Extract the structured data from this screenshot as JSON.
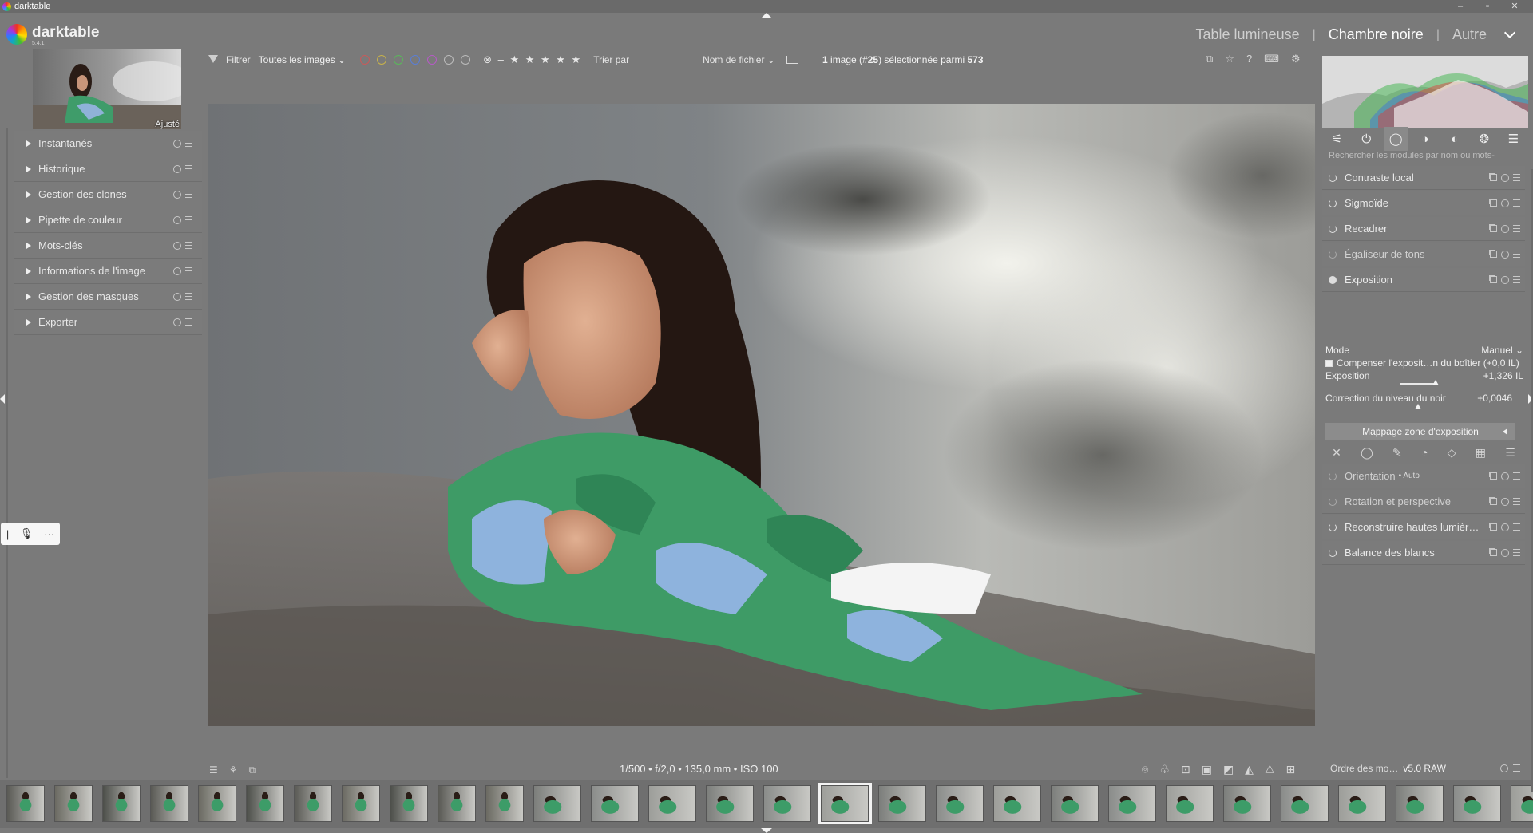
{
  "window": {
    "title": "darktable",
    "controls": [
      "–",
      "▫",
      "✕"
    ]
  },
  "app": {
    "name": "darktable",
    "version": "5.4.1"
  },
  "views": {
    "lighttable": "Table lumineuse",
    "darkroom": "Chambre noire",
    "other": "Autre"
  },
  "filterbar": {
    "filter_label": "Filtrer",
    "filter_value": "Toutes les images",
    "sort_label": "Trier par",
    "sort_value": "Nom de fichier",
    "rating_stars": "⊗ – ★ ★ ★ ★ ★",
    "color_labels": [
      "#c85a5a",
      "#c8b24a",
      "#5ab85a",
      "#5a7ed6",
      "#b65ac6"
    ]
  },
  "selection": {
    "count": "1",
    "text1": " image (#",
    "index": "25",
    "text2": ") sélectionnée parmi ",
    "total": "573"
  },
  "navigation": {
    "label": "Ajusté"
  },
  "left_modules": [
    {
      "label": "Instantanés"
    },
    {
      "label": "Historique"
    },
    {
      "label": "Gestion des clones"
    },
    {
      "label": "Pipette de couleur"
    },
    {
      "label": "Mots-clés"
    },
    {
      "label": "Informations de l'image"
    },
    {
      "label": "Gestion des masques"
    },
    {
      "label": "Exporter"
    }
  ],
  "search": {
    "placeholder": "Rechercher les modules par nom ou mots-"
  },
  "right_modules_top": [
    {
      "label": "Contraste local"
    },
    {
      "label": "Sigmoïde"
    },
    {
      "label": "Recadrer"
    },
    {
      "label": "Égaliseur de tons"
    },
    {
      "label": "Exposition"
    }
  ],
  "exposure": {
    "mode_label": "Mode",
    "mode_value": "Manuel ⌄",
    "compensate_label": "Compenser l'exposit…n du boîtier (+0,0 IL)",
    "exposure_label": "Exposition",
    "exposure_value": "+1,326 IL",
    "black_label": "Correction du niveau du noir",
    "black_value": "+0,0046",
    "zone_button": "Mappage zone d'exposition"
  },
  "right_modules_bottom": [
    {
      "label": "Orientation",
      "tag": "• Auto"
    },
    {
      "label": "Rotation et perspective",
      "tag": ""
    },
    {
      "label": "Reconstruire hautes lumièr…",
      "tag": ""
    },
    {
      "label": "Balance des blancs",
      "tag": ""
    }
  ],
  "bottom": {
    "exif": "1/500 • f/2,0 • 135,0 mm • ISO 100",
    "module_order_label": "Ordre des mo…",
    "module_order_value": "v5.0 RAW"
  },
  "voice_widget": {
    "mic": "🎙",
    "more": "···"
  },
  "group_icons": [
    "⚟",
    "⏻",
    "◯",
    "◑",
    "◐",
    "❂",
    "☰"
  ],
  "mask_icons": [
    "✕",
    "◯",
    "✎",
    "◔",
    "◇",
    "▦",
    "☰"
  ],
  "colors": {
    "background": "#7a7a7a",
    "panel": "#7b7b7b",
    "selected_thumb": "#f3f3f3"
  }
}
